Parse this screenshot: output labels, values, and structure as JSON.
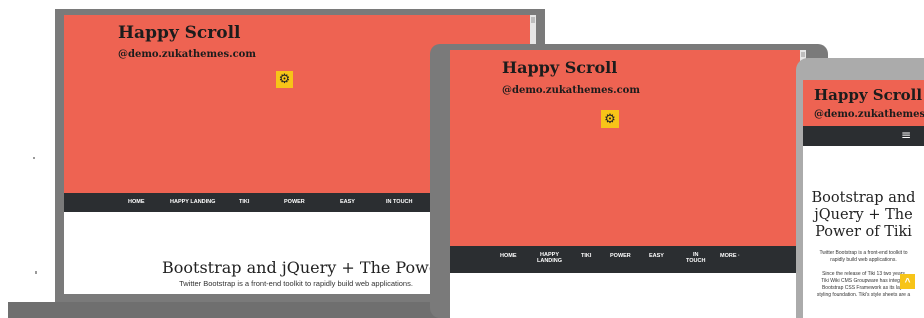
{
  "site": {
    "title": "Happy Scroll",
    "subtitle": "@demo.zukathemes.com",
    "gear_glyph": "⚙"
  },
  "nav": {
    "home": "HOME",
    "happy_landing": "HAPPY LANDING",
    "happy_landing_l1": "HAPPY",
    "happy_landing_l2": "LANDING",
    "tiki": "TIKI",
    "power": "POWER",
    "easy": "EASY",
    "in_touch": "IN TOUCH",
    "in_touch_l1": "IN",
    "in_touch_l2": "TOUCH",
    "more": "MORE ·",
    "hamburger_glyph": "≡"
  },
  "content": {
    "heading": "Bootstrap and jQuery + The Power of Tiki",
    "heading_l1": "Bootstrap and",
    "heading_l2": "jQuery + The",
    "heading_l3": "Power of Tiki",
    "lead": "Twitter Bootstrap is a front-end toolkit to rapidly build web applications.",
    "lead_l1": "Twitter Bootstrap is a front-end toolkit to",
    "lead_l2": "rapidly build web applications.",
    "para_l1": "Since the release of Tiki 13 two years",
    "para_l2": "Tiki Wiki CMS Groupware has integrat",
    "para_l3": "Bootstrap CSS Framework as its layo",
    "para_l4": "styling foundation. Tiki's style sheets are a"
  },
  "scroll_top_glyph": "^",
  "colors": {
    "hero": "#ee6352",
    "navbar": "#2b2e31",
    "gear_bg": "#f7c418",
    "device_frame": "#7a7a7a",
    "text_dark": "#1c1c1c"
  }
}
